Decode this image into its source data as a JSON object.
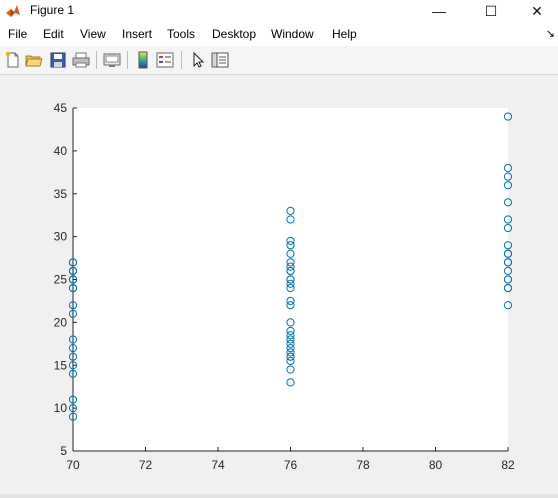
{
  "window": {
    "title": "Figure 1",
    "controls": [
      "—",
      "☐",
      "✕"
    ]
  },
  "menu": {
    "items": [
      "File",
      "Edit",
      "View",
      "Insert",
      "Tools",
      "Desktop",
      "Window",
      "Help"
    ],
    "overflow_glyph": "↘"
  },
  "toolbar": {
    "buttons": [
      "new-figure",
      "open-file",
      "save",
      "print",
      "link-plot",
      "insert-colorbar",
      "insert-legend",
      "edit-plot",
      "property-inspector"
    ]
  },
  "colors": {
    "marker": "#0072BD",
    "axes_bg": "#ffffff",
    "figure_bg": "#f0f0f0"
  },
  "chart_data": {
    "type": "scatter",
    "marker": "circle",
    "grid": false,
    "xlim": [
      70,
      82
    ],
    "ylim": [
      5,
      45
    ],
    "xticks": [
      "70",
      "72",
      "74",
      "76",
      "78",
      "80",
      "82"
    ],
    "yticks": [
      "5",
      "10",
      "15",
      "20",
      "25",
      "30",
      "35",
      "40",
      "45"
    ],
    "series": [
      {
        "x": [
          70,
          70,
          70,
          70,
          70,
          70,
          70,
          70,
          70,
          70,
          70,
          70,
          70,
          70,
          70,
          70,
          70,
          70,
          70,
          76,
          76,
          76,
          76,
          76,
          76,
          76,
          76,
          76,
          76,
          76,
          76,
          76,
          76,
          76,
          76,
          76,
          76,
          76,
          76,
          76,
          76,
          76,
          76,
          76,
          76,
          76,
          82,
          82,
          82,
          82,
          82,
          82,
          82,
          82,
          82,
          82,
          82,
          82,
          82,
          82,
          82,
          82,
          82,
          82
        ],
        "y": [
          9,
          10,
          11,
          14,
          15,
          16,
          17,
          18,
          21,
          22,
          24,
          25,
          25,
          26,
          27,
          27,
          26,
          25,
          24,
          13,
          14.5,
          15.5,
          16,
          16.5,
          17,
          18,
          18.5,
          19,
          20,
          22,
          22.5,
          24,
          24.5,
          25,
          26,
          26.5,
          27,
          28,
          29,
          29.5,
          32,
          33,
          26,
          25,
          17.5,
          16,
          22,
          24,
          25,
          26,
          27,
          28,
          29,
          31,
          32,
          34,
          36,
          37,
          38,
          44,
          27,
          28,
          25,
          24
        ]
      }
    ]
  }
}
